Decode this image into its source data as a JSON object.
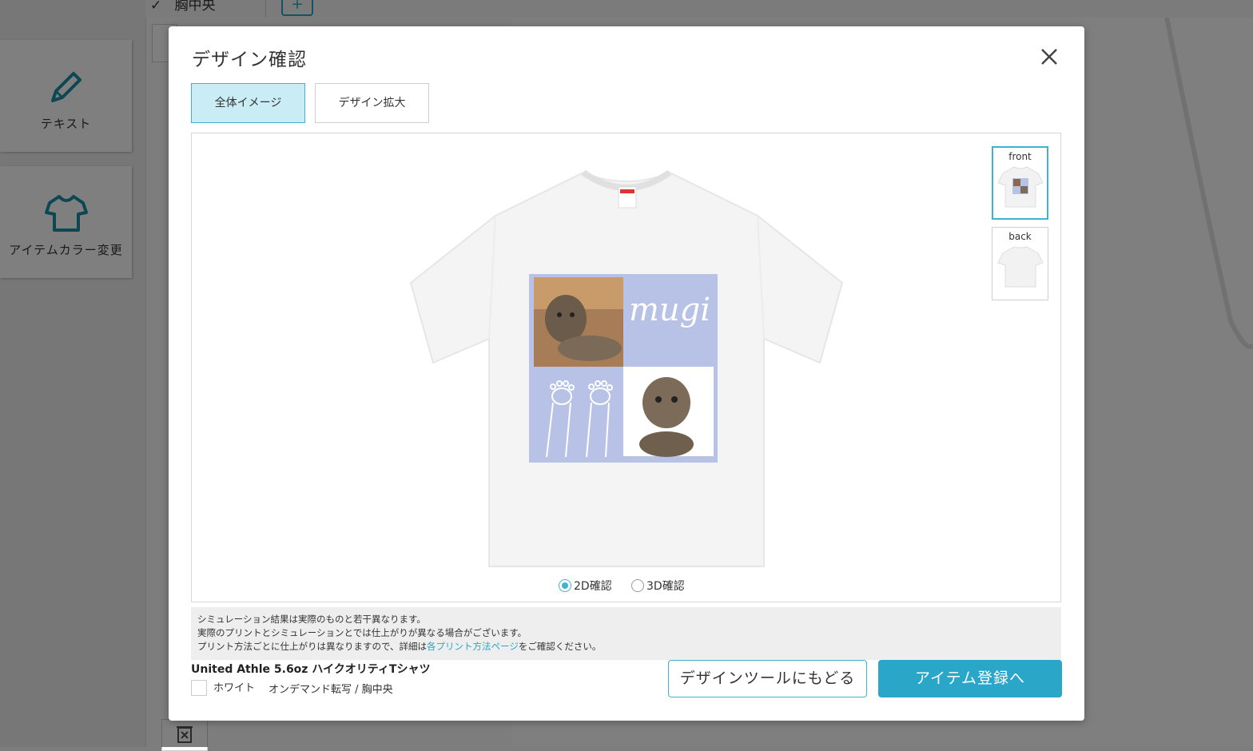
{
  "background": {
    "tab_label": "胸中央",
    "tools": [
      {
        "label": "テキスト",
        "icon": "pencil-icon"
      },
      {
        "label": "アイテムカラー変更",
        "icon": "tshirt-icon"
      }
    ]
  },
  "modal": {
    "title": "デザイン確認",
    "tabs": [
      {
        "label": "全体イメージ",
        "active": true
      },
      {
        "label": "デザイン拡大",
        "active": false
      }
    ],
    "design_text": "mugi",
    "thumbnails": [
      {
        "label": "front",
        "active": true
      },
      {
        "label": "back",
        "active": false
      }
    ],
    "view_modes": [
      {
        "label": "2D確認",
        "selected": true
      },
      {
        "label": "3D確認",
        "selected": false
      }
    ],
    "notice": {
      "line1": "シミュレーション結果は実際のものと若干異なります。",
      "line2": "実際のプリントとシミュレーションとでは仕上がりが異なる場合がございます。",
      "line3_pre": "プリント方法ごとに仕上がりは異なりますので、詳細は",
      "line3_link": "各プリント方法ページ",
      "line3_post": "をご確認ください。"
    },
    "product": {
      "name": "United Athle 5.6oz ハイクオリティTシャツ",
      "color": "ホワイト",
      "method": "オンデマンド転写 / 胸中央"
    },
    "buttons": {
      "back": "デザインツールにもどる",
      "next": "アイテム登録へ"
    }
  },
  "colors": {
    "accent": "#2aa6c9",
    "tab_active_bg": "#c9ecf5",
    "design_bg": "#b7c2e6"
  }
}
